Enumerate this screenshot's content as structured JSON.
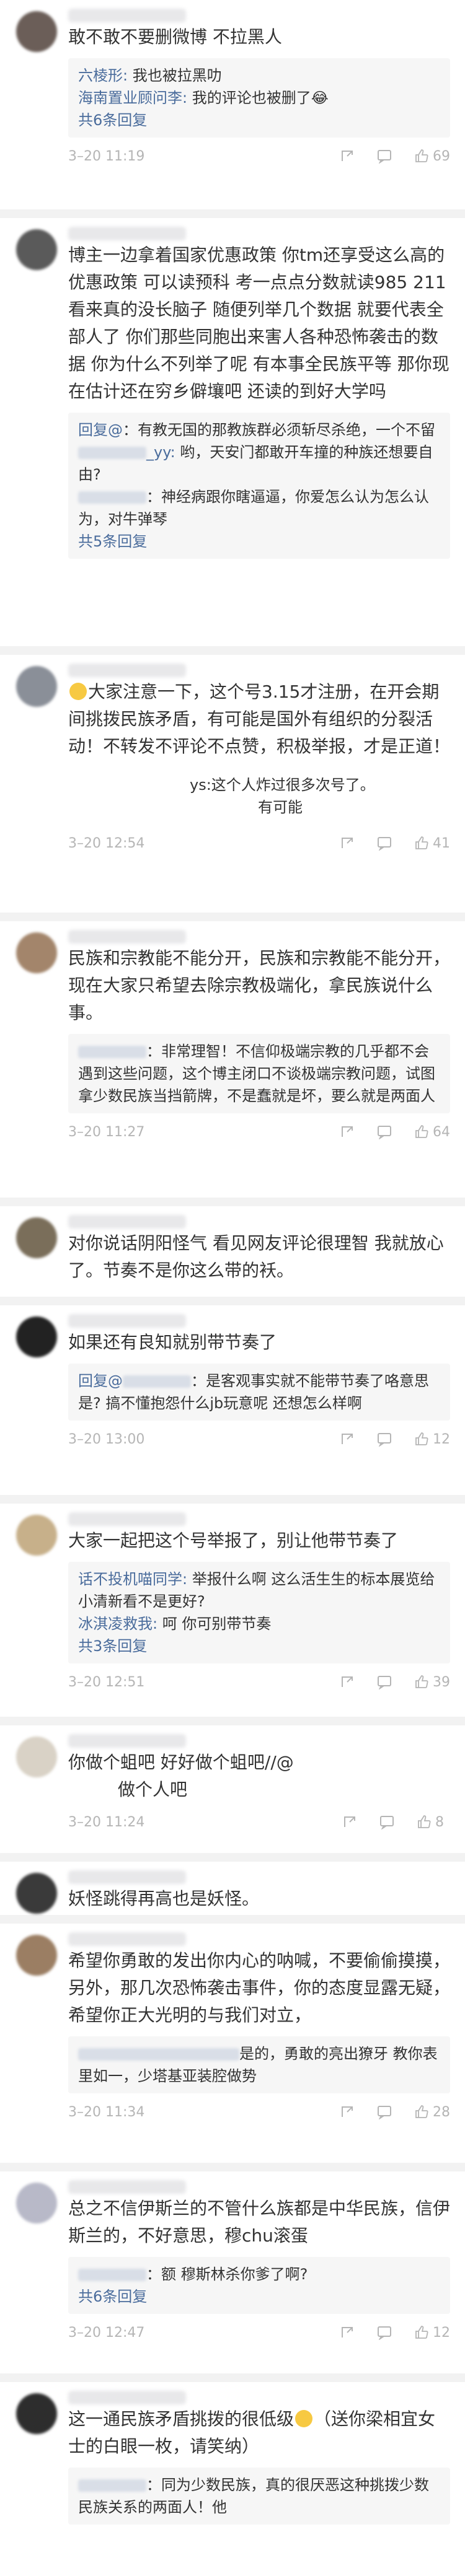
{
  "comments": [
    {
      "text": "敢不敢不要删微博 不拉黑人",
      "replies": [
        {
          "name": "六棱形:",
          "text": " 我也被拉黑叻"
        },
        {
          "name": "海南置业顾问李:",
          "text": " 我的评论也被删了😂"
        }
      ],
      "more": "共6条回复",
      "time": "3–20 11:19",
      "likes": "69"
    },
    {
      "text": "博主一边拿着国家优惠政策 你tm还享受这么高的优惠政策 可以读预科 考一点点分数就读985 211 看来真的没长脑子 随便列举几个数据 就要代表全部人了 你们那些同胞出来害人各种恐怖袭击的数据 你为什么不列举了呢 有本事全民族平等 那你现在估计还在穷乡僻壤吧 还读的到好大学吗",
      "replies": [
        {
          "name": "回复@",
          "text": "：有教无国的那教族群必须斩尽杀绝，一个不留"
        },
        {
          "name": "_yy:",
          "text": " 哟，天安门都敢开车撞的种族还想要自由?"
        },
        {
          "name": "",
          "text": "：神经病跟你瞎逼逼，你爱怎么认为怎么认为，对牛弹琴"
        }
      ],
      "more": "共5条回复",
      "time": "",
      "likes": ""
    },
    {
      "text": "大家注意一下，这个号3.15才注册，在开会期间挑拨民族矛盾，有可能是国外有组织的分裂活动！不转发不评论不点赞，积极举报，才是正道！",
      "replies": [
        {
          "name": "",
          "text": "ys:这个人炸过很多次号了。"
        },
        {
          "name": "",
          "text": "有可能"
        }
      ],
      "more": "",
      "time": "3–20 12:54",
      "likes": "41"
    },
    {
      "text": "民族和宗教能不能分开，民族和宗教能不能分开，现在大家只希望去除宗教极端化，拿民族说什么事。",
      "replies": [
        {
          "name": "",
          "text": "：非常理智！不信仰极端宗教的几乎都不会遇到这些问题，这个博主闭口不谈极端宗教问题，试图拿少数民族当挡箭牌，不是蠢就是坏，要么就是两面人"
        }
      ],
      "more": "",
      "time": "3–20 11:27",
      "likes": "64"
    },
    {
      "text": "对你说话阴阳怪气 看见网友评论很理智 我就放心了。节奏不是你这么带的袄。",
      "replies": [],
      "more": "",
      "time": "",
      "likes": ""
    },
    {
      "text": "如果还有良知就别带节奏了",
      "replies": [
        {
          "name": "回复@",
          "text": "：是客观事实就不能带节奏了咯意思是? 搞不懂抱怨什么jb玩意呢 还想怎么样啊"
        }
      ],
      "more": "",
      "time": "3–20 13:00",
      "likes": "12"
    },
    {
      "text": "大家一起把这个号举报了，别让他带节奏了",
      "replies": [
        {
          "name": "话不投机喵同学:",
          "text": " 举报什么啊 这么活生生的标本展览给小清新看不是更好?"
        },
        {
          "name": "冰淇凌救我:",
          "text": " 呵 你可别带节奏"
        }
      ],
      "more": "共3条回复",
      "time": "3–20 12:51",
      "likes": "39"
    },
    {
      "text": "你做个蛆吧 好好做个蛆吧//@",
      "text2": "做个人吧",
      "replies": [],
      "more": "",
      "time": "3–20 11:24",
      "likes": "8"
    },
    {
      "text": "妖怪跳得再高也是妖怪。",
      "replies": [],
      "more": "",
      "time": "",
      "likes": ""
    },
    {
      "text": "希望你勇敢的发出你内心的呐喊，不要偷偷摸摸，另外，那几次恐怖袭击事件，你的态度显露无疑，希望你正大光明的与我们对立，",
      "replies": [
        {
          "name": "",
          "text": "是的，勇敢的亮出獠牙 教你表里如一，少塔基亚装腔做势"
        }
      ],
      "more": "",
      "time": "3–20 11:34",
      "likes": "28"
    },
    {
      "text": "总之不信伊斯兰的不管什么族都是中华民族，信伊斯兰的，不好意思，穆chu滚蛋",
      "replies": [
        {
          "name": "",
          "text": "：额 穆斯林杀你爹了啊?"
        }
      ],
      "more": "共6条回复",
      "time": "3–20 12:47",
      "likes": "12"
    },
    {
      "text": "这一通民族矛盾挑拨的很低级",
      "text_after_emoji": "（送你梁相宜女士的白眼一枚，请笑纳）",
      "replies": [
        {
          "name": "",
          "text": "：同为少数民族，真的很厌恶这种挑拨少数民族关系的两面人！他"
        }
      ],
      "more": "",
      "time": "",
      "likes": ""
    }
  ]
}
